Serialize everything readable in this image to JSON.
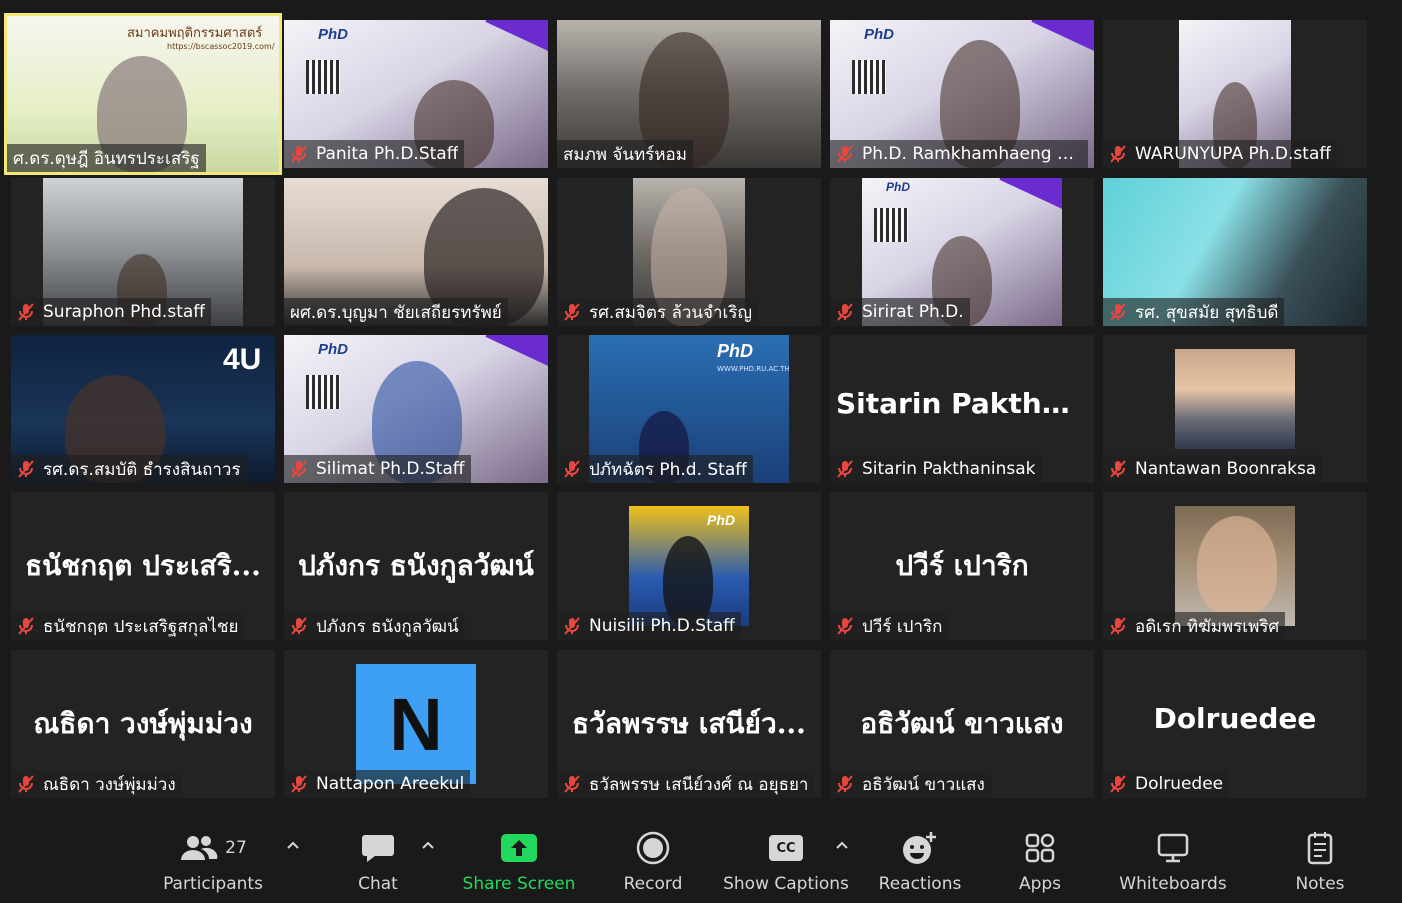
{
  "colors": {
    "active_speaker_border": "#f2e97a",
    "mute_icon": "#e8473f",
    "share_screen_green": "#23d95c",
    "tile_bg": "#232323",
    "background": "#1a1a1a"
  },
  "participants": [
    {
      "name": "ศ.ดร.ดุษฎี อินทรประเสริฐ",
      "muted": false,
      "active": true
    },
    {
      "name": "Panita Ph.D.Staff",
      "muted": true
    },
    {
      "name": "สมภพ จันทร์หอม",
      "muted": false
    },
    {
      "name": "Ph.D. Ramkhamhaeng Un...",
      "muted": true
    },
    {
      "name": "WARUNYUPA Ph.D.staff",
      "muted": true
    },
    {
      "name": "Suraphon Phd.staff",
      "muted": true
    },
    {
      "name": "ผศ.ดร.บุญมา ชัยเสถียรทรัพย์",
      "muted": false
    },
    {
      "name": "รศ.สมจิตร ล้วนจำเริญ",
      "muted": true
    },
    {
      "name": "Sirirat Ph.D.",
      "muted": true
    },
    {
      "name": "รศ. สุขสมัย สุทธิบดี",
      "muted": true
    },
    {
      "name": "รศ.ดร.สมบัติ ธำรงสินถาวร",
      "muted": true
    },
    {
      "name": "Silimat Ph.D.Staff",
      "muted": true
    },
    {
      "name": "ปภัทฉัตร Ph.d. Staff",
      "muted": true
    },
    {
      "name": "Sitarin Pakthaninsak",
      "muted": true,
      "big_name": "Sitarin  Pakthani..."
    },
    {
      "name": "Nantawan Boonraksa",
      "muted": true
    },
    {
      "name": "ธนัชกฤต ประเสริฐสกุลไชย",
      "muted": true,
      "big_name": "ธนัชกฤต ประเสริ..."
    },
    {
      "name": "ปภังกร ธนังกูลวัฒน์",
      "muted": true,
      "big_name": "ปภังกร ธนังกูลวัฒน์"
    },
    {
      "name": "Nuisilii Ph.D.Staff",
      "muted": true
    },
    {
      "name": "ปวีร์ เปาริก",
      "muted": true,
      "big_name": "ปวีร์  เปาริก"
    },
    {
      "name": "อดิเรก ทิฆัมพรเพริศ",
      "muted": true
    },
    {
      "name": "ณธิดา วงษ์พุ่มม่วง",
      "muted": true,
      "big_name": "ณธิดา วงษ์พุ่มม่วง"
    },
    {
      "name": "Nattapon Areekul",
      "muted": true,
      "avatar_letter": "N"
    },
    {
      "name": "ธวัลพรรษ เสนีย์วงศ์ ณ อยุธยา",
      "muted": true,
      "big_name": "ธวัลพรรษ เสนีย์ว..."
    },
    {
      "name": "อธิวัฒน์ ขาวแสง",
      "muted": true,
      "big_name": "อธิวัฒน์ ขาวแสง"
    },
    {
      "name": "Dolruedee",
      "muted": true,
      "big_name": "Dolruedee"
    }
  ],
  "overlays": {
    "society_name": "สมาคมพฤติกรรมศาสตร์",
    "society_url": "https://bscassoc2019.com/",
    "phd_logo": "PhD",
    "brand_4u": "4U",
    "phd_web": "WWW.PHD.RU.AC.TH"
  },
  "toolbar": {
    "participants_label": "Participants",
    "participants_count": "27",
    "chat_label": "Chat",
    "share_label": "Share Screen",
    "record_label": "Record",
    "captions_label": "Show Captions",
    "captions_icon_text": "CC",
    "reactions_label": "Reactions",
    "apps_label": "Apps",
    "whiteboards_label": "Whiteboards",
    "notes_label": "Notes"
  }
}
